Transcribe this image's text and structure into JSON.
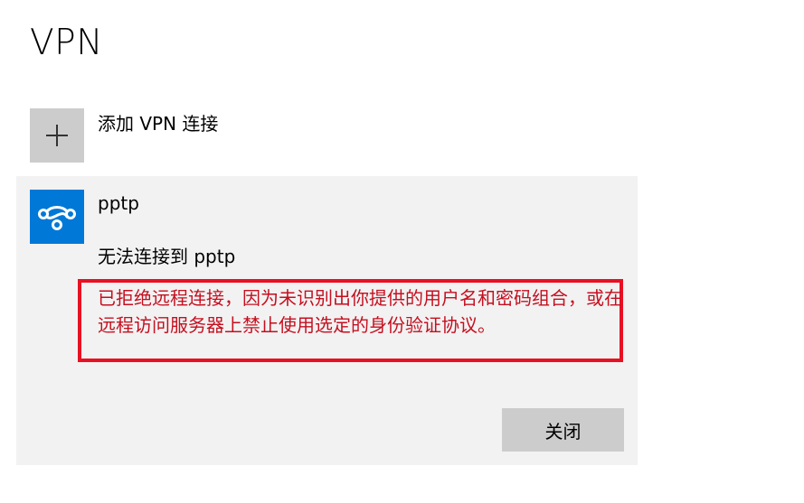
{
  "page": {
    "title": "VPN"
  },
  "add_vpn": {
    "label": "添加 VPN 连接",
    "icon": "plus-icon"
  },
  "connection": {
    "name": "pptp",
    "icon": "vpn-icon",
    "status_title": "无法连接到 pptp",
    "error_message": "已拒绝远程连接，因为未识别出你提供的用户名和密码组合，或在远程访问服务器上禁止使用选定的身份验证协议。",
    "close_label": "关闭"
  },
  "colors": {
    "accent": "#0078d7",
    "error": "#c50f1f",
    "error_border": "#e81123",
    "card_background": "#f2f2f2",
    "tile_background": "#cccccc"
  }
}
